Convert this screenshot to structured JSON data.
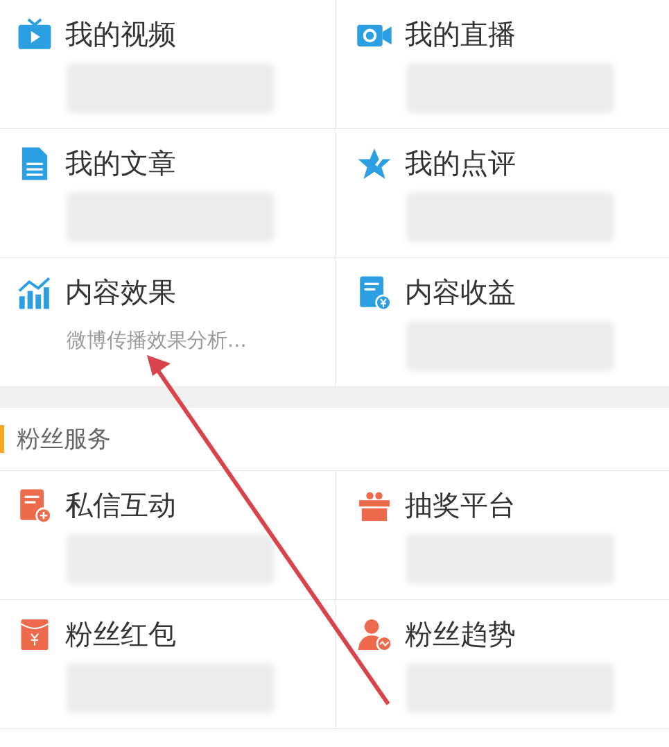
{
  "sections": [
    {
      "color": "#2c9fe3",
      "items": [
        {
          "kind": "tv",
          "title": "我的视频"
        },
        {
          "kind": "camera",
          "title": "我的直播"
        },
        {
          "kind": "document",
          "title": "我的文章"
        },
        {
          "kind": "star",
          "title": "我的点评"
        },
        {
          "kind": "chart",
          "title": "内容效果",
          "subtitle": "微博传播效果分析..."
        },
        {
          "kind": "yendoc",
          "title": "内容收益"
        }
      ]
    },
    {
      "header": "粉丝服务",
      "color": "#ee6a4c",
      "items": [
        {
          "kind": "message",
          "title": "私信互动"
        },
        {
          "kind": "gift",
          "title": "抽奖平台"
        },
        {
          "kind": "packet",
          "title": "粉丝红包"
        },
        {
          "kind": "person",
          "title": "粉丝趋势"
        }
      ]
    }
  ],
  "annotation": {
    "kind": "arrow"
  }
}
